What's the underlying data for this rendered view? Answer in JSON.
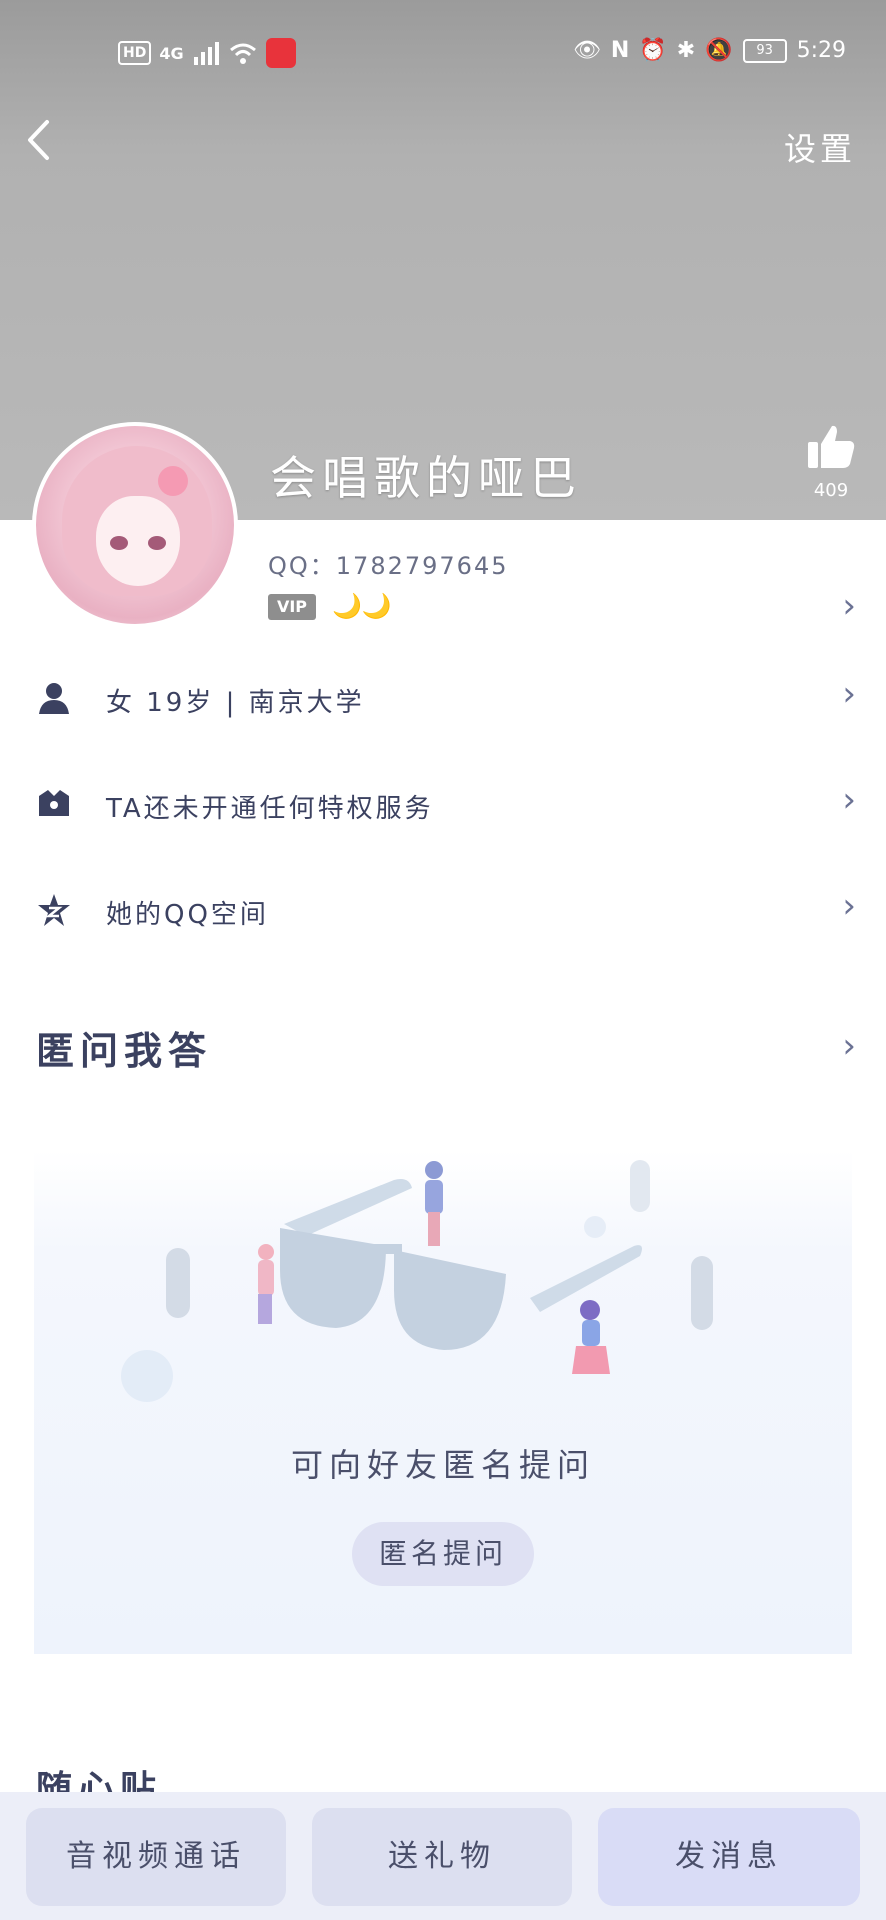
{
  "status_bar": {
    "hd": "HD",
    "network": "4G",
    "battery": "93",
    "time": "5:29"
  },
  "header": {
    "back_icon": "chevron-left-icon",
    "settings_label": "设置"
  },
  "profile": {
    "nickname": "会唱歌的哑巴",
    "likes": "409",
    "qq_label": "QQ：",
    "qq_number": "1782797645",
    "vip_label": "VIP",
    "level_moons": "🌙🌙"
  },
  "rows": [
    {
      "icon": "person-icon",
      "text": "女  19岁 | 南京大学"
    },
    {
      "icon": "crown-badge-icon",
      "text": "TA还未开通任何特权服务"
    },
    {
      "icon": "qzone-star-icon",
      "text": "她的QQ空间"
    }
  ],
  "qa": {
    "title": "匿问我答",
    "empty_text": "可向好友匿名提问",
    "button_label": "匿名提问"
  },
  "next_section": {
    "title": "随心贴"
  },
  "bottom_actions": {
    "video_call": "音视频通话",
    "send_gift": "送礼物",
    "send_message": "发消息"
  },
  "colors": {
    "header_gray": "#b9b9b9",
    "text_navy": "#3b4160",
    "accent_lavender": "#dcdff0"
  }
}
